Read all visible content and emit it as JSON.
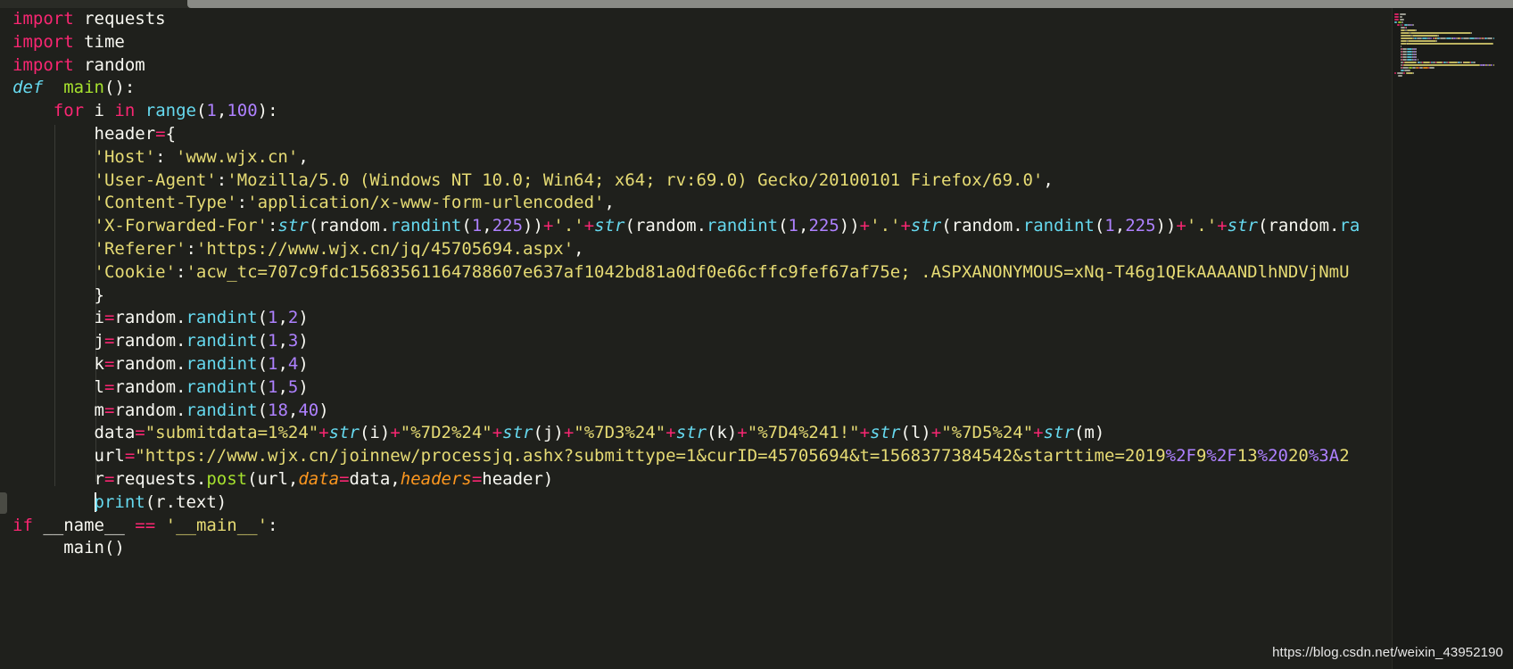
{
  "editor": {
    "theme": {
      "background": "#1f201c",
      "keyword": "#f92672",
      "string": "#e6db74",
      "number": "#ae81ff",
      "builtin": "#66d9ef",
      "function": "#a6e22e",
      "argument": "#fd971f",
      "text": "#f8f8f2"
    },
    "code_lines": [
      [
        [
          "kw",
          "import"
        ],
        [
          "plain",
          " requests"
        ]
      ],
      [
        [
          "kw",
          "import"
        ],
        [
          "plain",
          " time"
        ]
      ],
      [
        [
          "kw",
          "import"
        ],
        [
          "plain",
          " random"
        ]
      ],
      [
        [
          "def",
          "def"
        ],
        [
          "plain",
          "  "
        ],
        [
          "fn",
          "main"
        ],
        [
          "plain",
          "():"
        ]
      ],
      [
        [
          "plain",
          "    "
        ],
        [
          "kw",
          "for"
        ],
        [
          "plain",
          " i "
        ],
        [
          "kw",
          "in"
        ],
        [
          "plain",
          " "
        ],
        [
          "bi",
          "range"
        ],
        [
          "plain",
          "("
        ],
        [
          "num",
          "1"
        ],
        [
          "plain",
          ","
        ],
        [
          "num",
          "100"
        ],
        [
          "plain",
          "):"
        ]
      ],
      [
        [
          "plain",
          "        header"
        ],
        [
          "op",
          "="
        ],
        [
          "plain",
          "{"
        ]
      ],
      [
        [
          "plain",
          "        "
        ],
        [
          "str",
          "'Host'"
        ],
        [
          "plain",
          ": "
        ],
        [
          "str",
          "'www.wjx.cn'"
        ],
        [
          "plain",
          ","
        ]
      ],
      [
        [
          "plain",
          "        "
        ],
        [
          "str",
          "'User-Agent'"
        ],
        [
          "plain",
          ":"
        ],
        [
          "str",
          "'Mozilla/5.0 (Windows NT 10.0; Win64; x64; rv:69.0) Gecko/20100101 Firefox/69.0'"
        ],
        [
          "plain",
          ","
        ]
      ],
      [
        [
          "plain",
          "        "
        ],
        [
          "str",
          "'Content-Type'"
        ],
        [
          "plain",
          ":"
        ],
        [
          "str",
          "'application/x-www-form-urlencoded'"
        ],
        [
          "plain",
          ","
        ]
      ],
      [
        [
          "plain",
          "        "
        ],
        [
          "str",
          "'X-Forwarded-For'"
        ],
        [
          "plain",
          ":"
        ],
        [
          "biit",
          "str"
        ],
        [
          "plain",
          "(random."
        ],
        [
          "meth",
          "randint"
        ],
        [
          "plain",
          "("
        ],
        [
          "num",
          "1"
        ],
        [
          "plain",
          ","
        ],
        [
          "num",
          "225"
        ],
        [
          "plain",
          "))"
        ],
        [
          "op",
          "+"
        ],
        [
          "str",
          "'.'"
        ],
        [
          "op",
          "+"
        ],
        [
          "biit",
          "str"
        ],
        [
          "plain",
          "(random."
        ],
        [
          "meth",
          "randint"
        ],
        [
          "plain",
          "("
        ],
        [
          "num",
          "1"
        ],
        [
          "plain",
          ","
        ],
        [
          "num",
          "225"
        ],
        [
          "plain",
          "))"
        ],
        [
          "op",
          "+"
        ],
        [
          "str",
          "'.'"
        ],
        [
          "op",
          "+"
        ],
        [
          "biit",
          "str"
        ],
        [
          "plain",
          "(random."
        ],
        [
          "meth",
          "randint"
        ],
        [
          "plain",
          "("
        ],
        [
          "num",
          "1"
        ],
        [
          "plain",
          ","
        ],
        [
          "num",
          "225"
        ],
        [
          "plain",
          "))"
        ],
        [
          "op",
          "+"
        ],
        [
          "str",
          "'.'"
        ],
        [
          "op",
          "+"
        ],
        [
          "biit",
          "str"
        ],
        [
          "plain",
          "(random."
        ],
        [
          "meth",
          "ra"
        ]
      ],
      [
        [
          "plain",
          "        "
        ],
        [
          "str",
          "'Referer'"
        ],
        [
          "plain",
          ":"
        ],
        [
          "str",
          "'https://www.wjx.cn/jq/45705694.aspx'"
        ],
        [
          "plain",
          ","
        ]
      ],
      [
        [
          "plain",
          "        "
        ],
        [
          "str",
          "'Cookie'"
        ],
        [
          "plain",
          ":"
        ],
        [
          "str",
          "'acw_tc=707c9fdc15683561164788607e637af1042bd81a0df0e66cffc9fef67af75e; .ASPXANONYMOUS=xNq-T46g1QEkAAAANDlhNDVjNmU"
        ]
      ],
      [
        [
          "plain",
          "        }"
        ]
      ],
      [
        [
          "plain",
          "        i"
        ],
        [
          "op",
          "="
        ],
        [
          "plain",
          "random."
        ],
        [
          "meth",
          "randint"
        ],
        [
          "plain",
          "("
        ],
        [
          "num",
          "1"
        ],
        [
          "plain",
          ","
        ],
        [
          "num",
          "2"
        ],
        [
          "plain",
          ")"
        ]
      ],
      [
        [
          "plain",
          "        j"
        ],
        [
          "op",
          "="
        ],
        [
          "plain",
          "random."
        ],
        [
          "meth",
          "randint"
        ],
        [
          "plain",
          "("
        ],
        [
          "num",
          "1"
        ],
        [
          "plain",
          ","
        ],
        [
          "num",
          "3"
        ],
        [
          "plain",
          ")"
        ]
      ],
      [
        [
          "plain",
          "        k"
        ],
        [
          "op",
          "="
        ],
        [
          "plain",
          "random."
        ],
        [
          "meth",
          "randint"
        ],
        [
          "plain",
          "("
        ],
        [
          "num",
          "1"
        ],
        [
          "plain",
          ","
        ],
        [
          "num",
          "4"
        ],
        [
          "plain",
          ")"
        ]
      ],
      [
        [
          "plain",
          "        l"
        ],
        [
          "op",
          "="
        ],
        [
          "plain",
          "random."
        ],
        [
          "meth",
          "randint"
        ],
        [
          "plain",
          "("
        ],
        [
          "num",
          "1"
        ],
        [
          "plain",
          ","
        ],
        [
          "num",
          "5"
        ],
        [
          "plain",
          ")"
        ]
      ],
      [
        [
          "plain",
          "        m"
        ],
        [
          "op",
          "="
        ],
        [
          "plain",
          "random."
        ],
        [
          "meth",
          "randint"
        ],
        [
          "plain",
          "("
        ],
        [
          "num",
          "18"
        ],
        [
          "plain",
          ","
        ],
        [
          "num",
          "40"
        ],
        [
          "plain",
          ")"
        ]
      ],
      [
        [
          "plain",
          "        data"
        ],
        [
          "op",
          "="
        ],
        [
          "str",
          "\"submitdata=1%24\""
        ],
        [
          "op",
          "+"
        ],
        [
          "biit",
          "str"
        ],
        [
          "plain",
          "(i)"
        ],
        [
          "op",
          "+"
        ],
        [
          "str",
          "\"%7D2%24\""
        ],
        [
          "op",
          "+"
        ],
        [
          "biit",
          "str"
        ],
        [
          "plain",
          "(j)"
        ],
        [
          "op",
          "+"
        ],
        [
          "str",
          "\"%7D3%24\""
        ],
        [
          "op",
          "+"
        ],
        [
          "biit",
          "str"
        ],
        [
          "plain",
          "(k)"
        ],
        [
          "op",
          "+"
        ],
        [
          "str",
          "\"%7D4%241!\""
        ],
        [
          "op",
          "+"
        ],
        [
          "biit",
          "str"
        ],
        [
          "plain",
          "(l)"
        ],
        [
          "op",
          "+"
        ],
        [
          "str",
          "\"%7D5%24\""
        ],
        [
          "op",
          "+"
        ],
        [
          "biit",
          "str"
        ],
        [
          "plain",
          "(m)"
        ]
      ],
      [
        [
          "plain",
          "        url"
        ],
        [
          "op",
          "="
        ],
        [
          "str",
          "\"https://www.wjx.cn/joinnew/processjq.ashx?submittype=1&curID=45705694&t=1568377384542&starttime=2019"
        ],
        [
          "esc",
          "%2F"
        ],
        [
          "str",
          "9"
        ],
        [
          "esc",
          "%2F"
        ],
        [
          "str",
          "13"
        ],
        [
          "esc",
          "%20"
        ],
        [
          "str",
          "20"
        ],
        [
          "esc",
          "%3A"
        ],
        [
          "str",
          "2"
        ]
      ],
      [
        [
          "plain",
          "        r"
        ],
        [
          "op",
          "="
        ],
        [
          "plain",
          "requests."
        ],
        [
          "fn",
          "post"
        ],
        [
          "plain",
          "(url,"
        ],
        [
          "arg",
          "data"
        ],
        [
          "op",
          "="
        ],
        [
          "plain",
          "data,"
        ],
        [
          "arg",
          "headers"
        ],
        [
          "op",
          "="
        ],
        [
          "plain",
          "header)"
        ]
      ],
      [
        [
          "plain",
          "        "
        ],
        [
          "caret",
          ""
        ],
        [
          "bi",
          "print"
        ],
        [
          "plain",
          "(r.text)"
        ]
      ],
      [
        [
          "kw",
          "if"
        ],
        [
          "plain",
          " __name__ "
        ],
        [
          "op",
          "=="
        ],
        [
          "plain",
          " "
        ],
        [
          "str",
          "'__main__'"
        ],
        [
          "plain",
          ":"
        ]
      ],
      [
        [
          "plain",
          "    "
        ],
        [
          "plain",
          " main()"
        ]
      ]
    ]
  },
  "watermark": "https://blog.csdn.net/weixin_43952190"
}
